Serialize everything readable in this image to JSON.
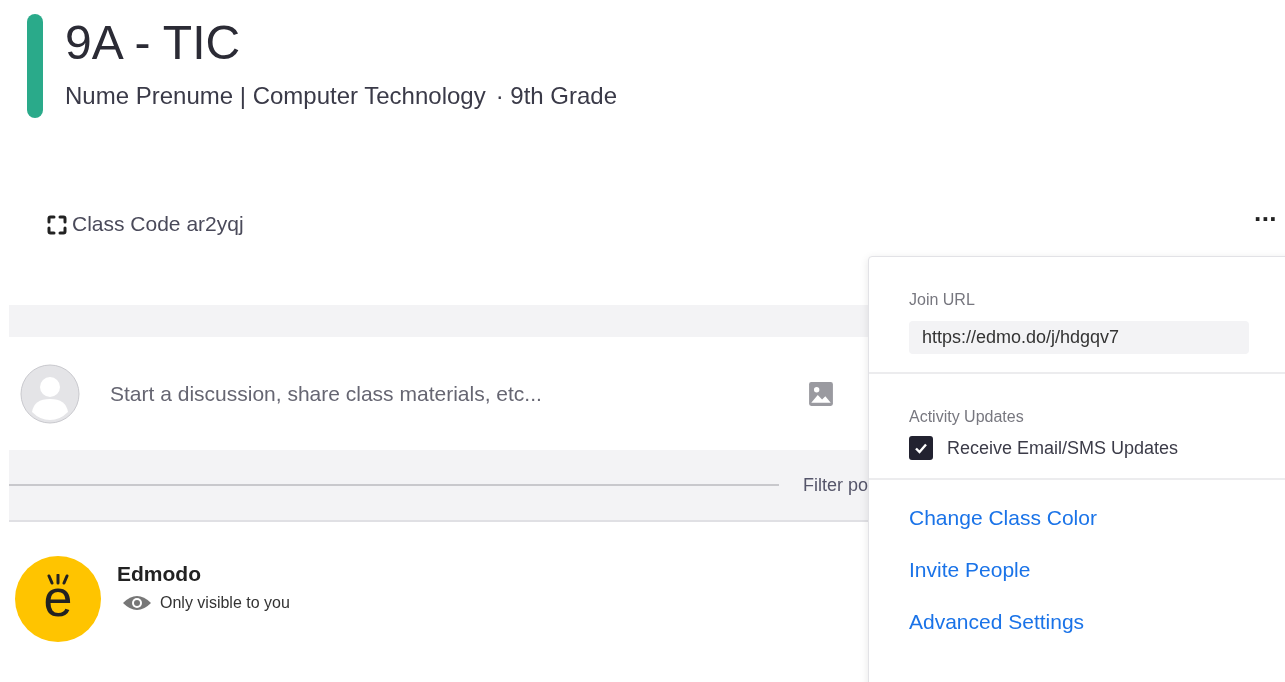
{
  "class": {
    "title": "9A - TIC",
    "subtitle": "Nume Prenume | Computer Technology",
    "grade": "· 9th Grade",
    "class_code": "Class Code ar2yqj"
  },
  "more_button": "···",
  "composer": {
    "placeholder": "Start a discussion, share class materials, etc..."
  },
  "filter": {
    "label": "Filter po"
  },
  "post": {
    "author": "Edmodo",
    "visibility": "Only visible to you",
    "avatar_letter": "e"
  },
  "menu": {
    "join_url_label": "Join URL",
    "join_url": "https://edmo.do/j/hdgqv7",
    "activity_label": "Activity Updates",
    "updates": {
      "label": "Receive Email/SMS Updates",
      "checked": true
    },
    "links": [
      "Change Class Color",
      "Invite People",
      "Advanced Settings"
    ]
  }
}
